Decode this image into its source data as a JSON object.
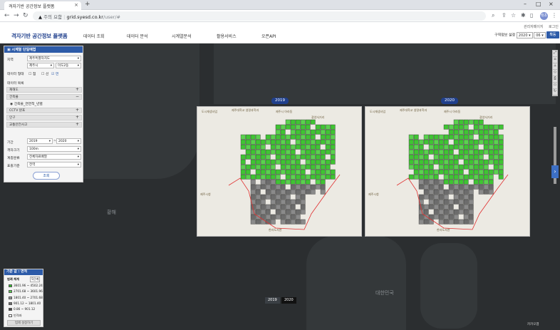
{
  "browser": {
    "tab_title": "격자기반 공간정보 플랫폼",
    "url_warning": "주의 요함",
    "url_host": "grid.syesd.co.kr",
    "url_path": "/user/#",
    "profile_initials": "태초"
  },
  "header": {
    "util_left": "관리자페이지",
    "util_right": "로그인",
    "logo": "격자기반 공간정보 플랫폼",
    "menu": [
      "데이터 조회",
      "데이터 분석",
      "시계열분석",
      "활용서비스",
      "오픈API"
    ],
    "date_label": "구역정보 설정",
    "date_year": "2020",
    "date_month": "06",
    "move_button": "확동"
  },
  "panel": {
    "title": "시계열 단일예엽",
    "region_label": "지역",
    "region_value": "제주특별자치도",
    "region_city": "제주시",
    "region_dong": "이도2동",
    "data_type_label": "데이터 형태",
    "opt_point": "점",
    "opt_line": "선",
    "opt_area": "면",
    "data_list_label": "데이터 목록",
    "sections": [
      "재해도",
      "건축물",
      "CCTV 분포",
      "인구",
      "교통안전사고"
    ],
    "building_item": "건축물_연면적_년별",
    "period_label": "기간",
    "period_from": "2019",
    "period_to": "2020",
    "grid_size_label": "격자크기",
    "grid_size_value": "100m",
    "classify_label": "계층분류",
    "classify_value": "전체자료배열",
    "display_label": "표출기준",
    "display_value": "전역",
    "search_button": "조회"
  },
  "maps": {
    "left_year": "2019",
    "right_year": "2020",
    "poi_labels": [
      "도시재생사업",
      "제주시청",
      "제주대학교 생명과학과",
      "제주시 아라동",
      "광양사거리",
      "한라도서관"
    ]
  },
  "map_labels": {
    "ocean_west": "황해",
    "ocean_east": "대한민국"
  },
  "legend": {
    "title": "기준 값 : 면적",
    "class_label": "범례 체계",
    "class_value": "5단계",
    "items": [
      {
        "range": "3601.96 ~ 4502.24",
        "color": "#2fc22a"
      },
      {
        "range": "2701.68 ~ 3601.96",
        "color": "#56d04d"
      },
      {
        "range": "1801.40 ~ 2701.68",
        "color": "#9a9a9a"
      },
      {
        "range": "901.12 ~ 1801.40",
        "color": "#6f6f6f"
      },
      {
        "range": "0.86 ~ 901.12",
        "color": "#4a4a4a"
      },
      {
        "range": "빈격자",
        "color": "#ffffff"
      }
    ],
    "footer_button": "범례 설정하기"
  },
  "timeline": [
    "2019",
    "2020"
  ],
  "map_credit": "카카오맵"
}
